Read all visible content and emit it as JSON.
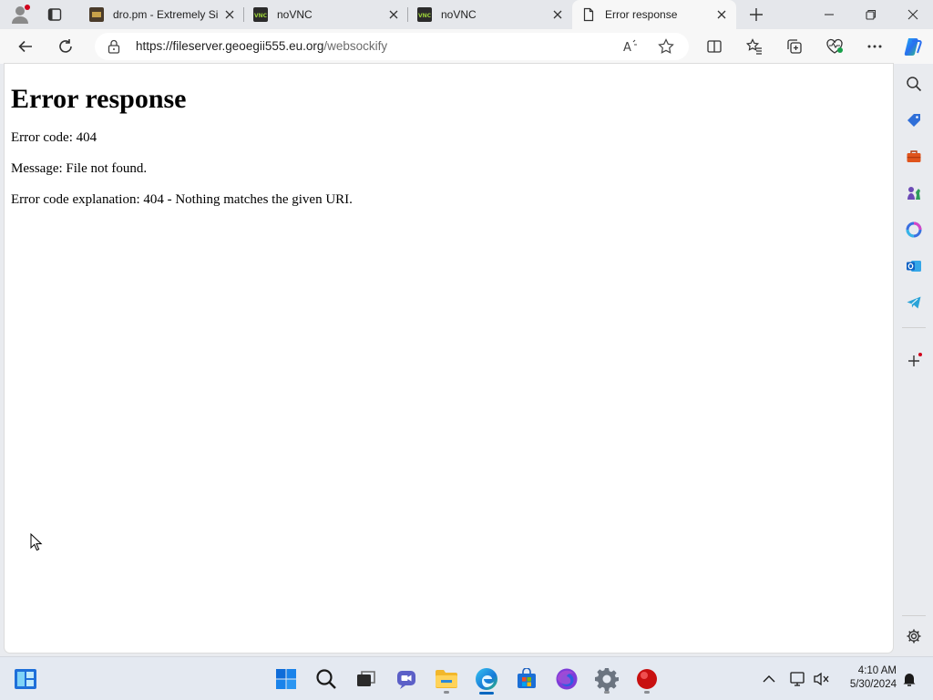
{
  "browser": {
    "tabs": [
      {
        "title": "dro.pm - Extremely Si",
        "favicon": "dro-pm-favicon",
        "active": false
      },
      {
        "title": "noVNC",
        "favicon": "novnc-favicon",
        "active": false
      },
      {
        "title": "noVNC",
        "favicon": "novnc-favicon",
        "active": false
      },
      {
        "title": "Error response",
        "favicon": "page-favicon",
        "active": true
      }
    ],
    "address": {
      "host": "https://fileserver.geoegii555.eu.org",
      "path": "/websockify"
    },
    "accent": "#0067c0"
  },
  "page": {
    "heading": "Error response",
    "error_code": "Error code: 404",
    "message": "Message: File not found.",
    "explanation": "Error code explanation: 404 - Nothing matches the given URI."
  },
  "sidebar": {
    "items": [
      "search-icon",
      "tag-icon",
      "toolbox-icon",
      "chess-icon",
      "m365-icon",
      "outlook-icon",
      "telegram-icon",
      "add-icon",
      "settings-icon"
    ]
  },
  "taskbar": {
    "apps": [
      "start-icon",
      "search-icon",
      "task-view-icon",
      "meet-icon",
      "file-explorer-icon",
      "edge-icon",
      "store-icon",
      "firefox-icon",
      "settings-icon",
      "record-icon"
    ],
    "time": "4:10 AM",
    "date": "5/30/2024"
  }
}
